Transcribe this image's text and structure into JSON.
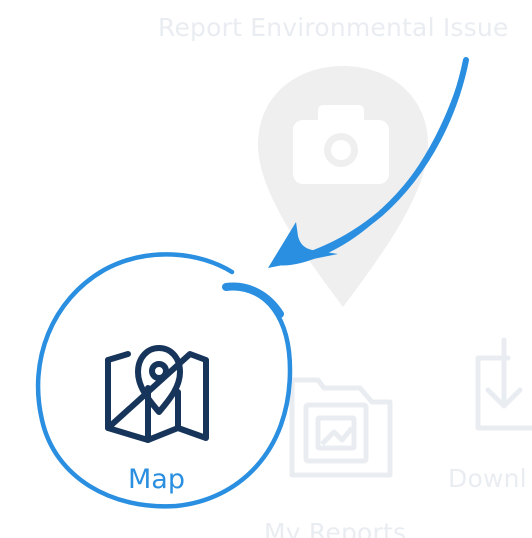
{
  "report": {
    "title": "Report Environmental Issue",
    "icon": "camera-pin-icon"
  },
  "menu": {
    "map_label": "Map",
    "my_reports_label": "My Reports",
    "downloads_label": "Downl"
  },
  "highlight": {
    "target": "Map",
    "annotation": "arrow-icon"
  },
  "colors": {
    "accent": "#2a8fe0",
    "icon_dark": "#17355a",
    "faded": "#e9edf2",
    "pin_gray": "#efefef",
    "background": "#ffffff"
  }
}
